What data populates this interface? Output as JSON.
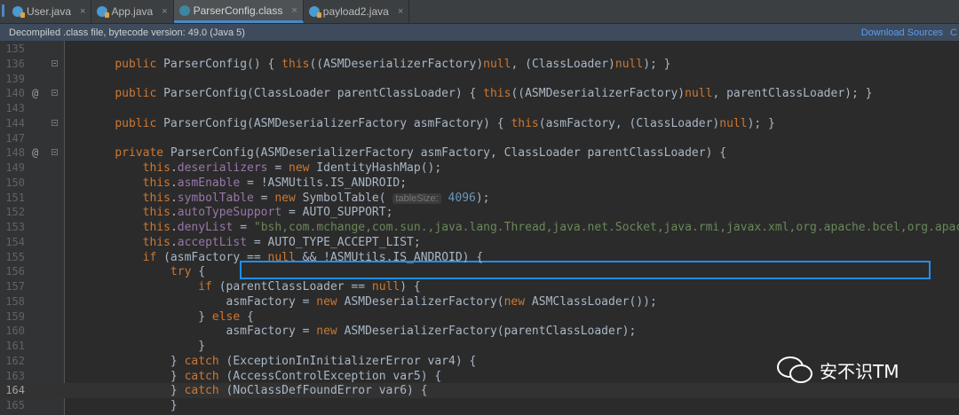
{
  "tabs": [
    {
      "label": "User.java",
      "type": "java",
      "active": false
    },
    {
      "label": "App.java",
      "type": "java",
      "active": false
    },
    {
      "label": "ParserConfig.class",
      "type": "class",
      "active": true
    },
    {
      "label": "payload2.java",
      "type": "java",
      "active": false
    }
  ],
  "tab_close_glyph": "×",
  "infobar": {
    "message": "Decompiled .class file, bytecode version: 49.0 (Java 5)",
    "download_sources": "Download Sources",
    "choose_sources": "C"
  },
  "gutter": {
    "override_marker": "@"
  },
  "lines": [
    {
      "n": "135",
      "code": ""
    },
    {
      "n": "136",
      "fold": true,
      "code": "    public ParserConfig() { this((ASMDeserializerFactory)null, (ClassLoader)null); }"
    },
    {
      "n": "139",
      "code": ""
    },
    {
      "n": "140",
      "ann": true,
      "fold": true,
      "code": "    public ParserConfig(ClassLoader parentClassLoader) { this((ASMDeserializerFactory)null, parentClassLoader); }"
    },
    {
      "n": "143",
      "code": ""
    },
    {
      "n": "144",
      "fold": true,
      "code": "    public ParserConfig(ASMDeserializerFactory asmFactory) { this(asmFactory, (ClassLoader)null); }"
    },
    {
      "n": "147",
      "code": ""
    },
    {
      "n": "148",
      "ann": true,
      "fold": true,
      "code": "    private ParserConfig(ASMDeserializerFactory asmFactory, ClassLoader parentClassLoader) {"
    },
    {
      "n": "149",
      "code": "        this.deserializers = new IdentityHashMap();"
    },
    {
      "n": "150",
      "code": "        this.asmEnable = !ASMUtils.IS_ANDROID;"
    },
    {
      "n": "151",
      "code": "        this.symbolTable = new SymbolTable( tableSize: 4096);"
    },
    {
      "n": "152",
      "code": "        this.autoTypeSupport = AUTO_SUPPORT;"
    },
    {
      "n": "153",
      "code": "        this.denyList = \"bsh,com.mchange,com.sun.,java.lang.Thread,java.net.Socket,java.rmi,javax.xml,org.apache.bcel,org.apache.com"
    },
    {
      "n": "154",
      "code": "        this.acceptList = AUTO_TYPE_ACCEPT_LIST;"
    },
    {
      "n": "155",
      "code": "        if (asmFactory == null && !ASMUtils.IS_ANDROID) {"
    },
    {
      "n": "156",
      "code": "            try {"
    },
    {
      "n": "157",
      "code": "                if (parentClassLoader == null) {"
    },
    {
      "n": "158",
      "code": "                    asmFactory = new ASMDeserializerFactory(new ASMClassLoader());"
    },
    {
      "n": "159",
      "code": "                } else {"
    },
    {
      "n": "160",
      "code": "                    asmFactory = new ASMDeserializerFactory(parentClassLoader);"
    },
    {
      "n": "161",
      "code": "                }"
    },
    {
      "n": "162",
      "code": "            } catch (ExceptionInInitializerError var4) {"
    },
    {
      "n": "163",
      "code": "            } catch (AccessControlException var5) {"
    },
    {
      "n": "164",
      "current": true,
      "code": "            } catch (NoClassDefFoundError var6) {"
    },
    {
      "n": "165",
      "code": "            }"
    }
  ],
  "watermark": {
    "text": "安不识TM"
  }
}
